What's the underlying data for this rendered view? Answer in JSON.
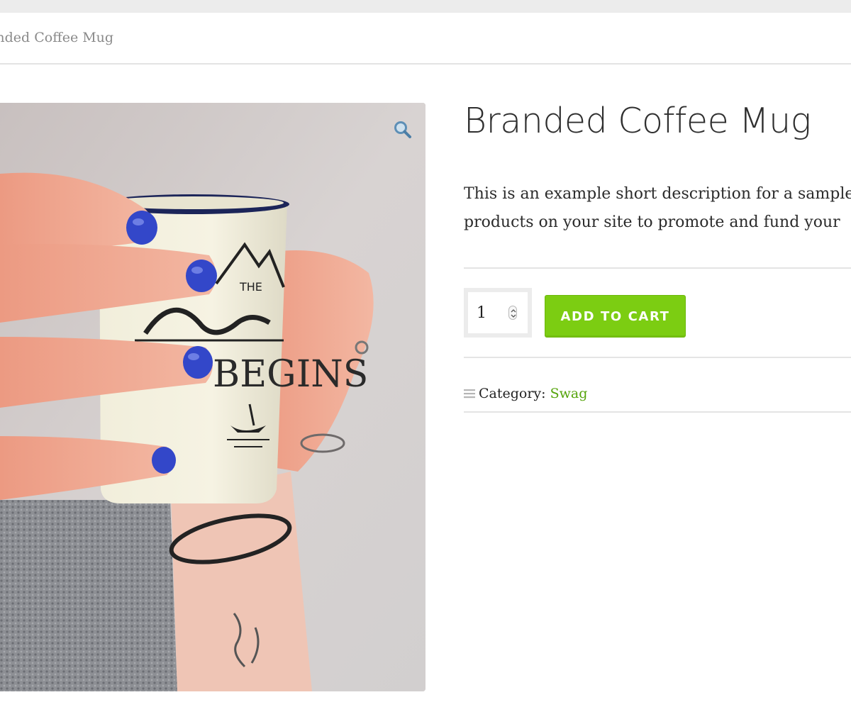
{
  "breadcrumb": {
    "current": "Branded Coffee Mug"
  },
  "product": {
    "title": "Branded Coffee Mug",
    "description_lines": [
      "This is an example short description for a sample",
      "products on your site to promote and fund your"
    ],
    "quantity": "1",
    "add_to_cart_label": "ADD TO CART",
    "category_label": "Category:",
    "category_value": "Swag"
  },
  "icons": {
    "zoom": "magnifier-icon",
    "meta": "list-icon",
    "spin": "stepper-icon"
  },
  "colors": {
    "accent_green": "#7ccd12",
    "link_green": "#55a40b",
    "nail_blue": "#3347c9"
  }
}
